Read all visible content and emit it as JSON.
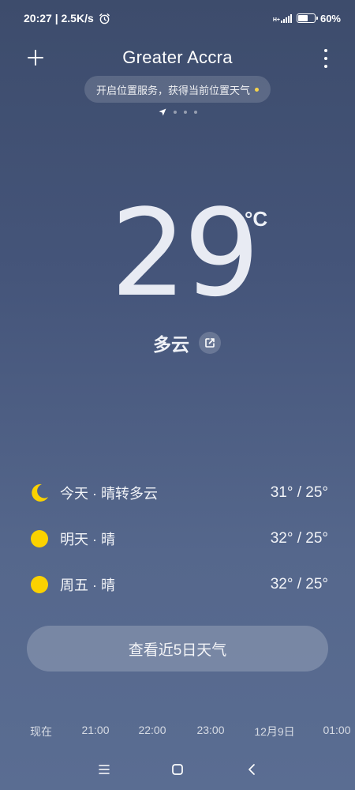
{
  "status_bar": {
    "time_speed": "20:27 | 2.5K/s",
    "network_label": "H+",
    "battery_text": "60%",
    "battery_level": 0.6
  },
  "header": {
    "city": "Greater Accra"
  },
  "location_banner": {
    "text": "开启位置服务，获得当前位置天气"
  },
  "current": {
    "temperature": "29",
    "unit": "°C",
    "condition": "多云"
  },
  "forecast": [
    {
      "icon": "crescent-moon-icon",
      "label": "今天 · 晴转多云",
      "temps": "31° / 25°"
    },
    {
      "icon": "sun-icon",
      "label": "明天 · 晴",
      "temps": "32° / 25°"
    },
    {
      "icon": "sun-icon",
      "label": "周五 · 晴",
      "temps": "32° / 25°"
    }
  ],
  "five_day_button": {
    "label": "查看近5日天气"
  },
  "hourly": [
    {
      "time": "现在"
    },
    {
      "time": "21:00"
    },
    {
      "time": "22:00"
    },
    {
      "time": "23:00"
    },
    {
      "time": "12月9日"
    },
    {
      "time": "01:00"
    }
  ],
  "colors": {
    "sun": "#fbd200",
    "banner_dot": "#f7d44a"
  }
}
